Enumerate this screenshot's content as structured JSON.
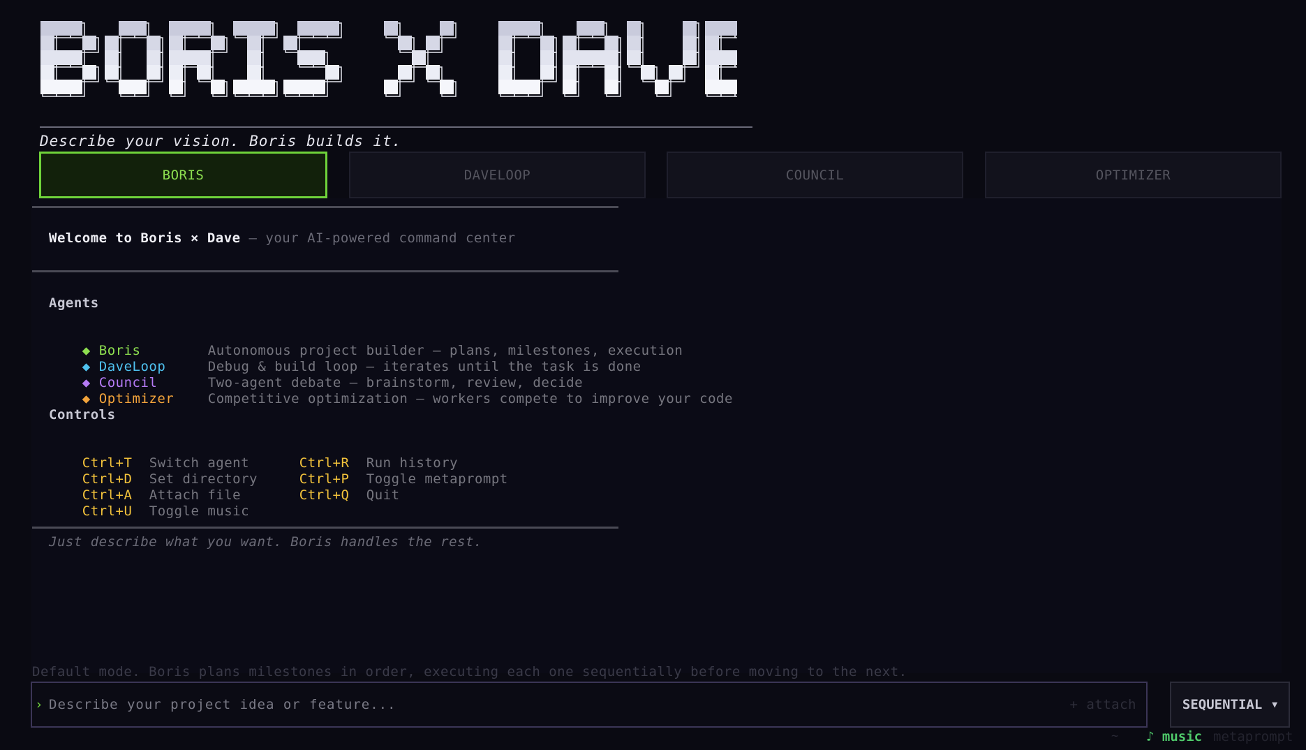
{
  "app": {
    "logo_text": "BORIS X DAVE",
    "tagline": "Describe your vision. Boris builds it."
  },
  "tabs": [
    {
      "label": "BORIS",
      "active": true
    },
    {
      "label": "DAVELOOP",
      "active": false
    },
    {
      "label": "COUNCIL",
      "active": false
    },
    {
      "label": "OPTIMIZER",
      "active": false
    }
  ],
  "welcome": {
    "bold": "Welcome to Boris × Dave",
    "rest": " — your AI-powered command center"
  },
  "agents": {
    "title": "Agents",
    "items": [
      {
        "diamond": "◆",
        "name": "Boris",
        "desc": "Autonomous project builder — plans, milestones, execution",
        "color": "#8ee050"
      },
      {
        "diamond": "◆",
        "name": "DaveLoop",
        "desc": "Debug & build loop — iterates until the task is done",
        "color": "#4fc2f0"
      },
      {
        "diamond": "◆",
        "name": "Council",
        "desc": "Two-agent debate — brainstorm, review, decide",
        "color": "#b57bf5"
      },
      {
        "diamond": "◆",
        "name": "Optimizer",
        "desc": "Competitive optimization — workers compete to improve your code",
        "color": "#f2a33b"
      }
    ]
  },
  "controls": {
    "title": "Controls",
    "left": [
      {
        "key": "Ctrl+T",
        "action": "Switch agent"
      },
      {
        "key": "Ctrl+D",
        "action": "Set directory"
      },
      {
        "key": "Ctrl+A",
        "action": "Attach file"
      },
      {
        "key": "Ctrl+U",
        "action": "Toggle music"
      }
    ],
    "right": [
      {
        "key": "Ctrl+R",
        "action": "Run history"
      },
      {
        "key": "Ctrl+P",
        "action": "Toggle metaprompt"
      },
      {
        "key": "Ctrl+Q",
        "action": "Quit"
      }
    ]
  },
  "footer_text": "Just describe what you want. Boris handles the rest.",
  "mode_description": "Default mode. Boris plans milestones in order, executing each one sequentially before moving to the next.",
  "input": {
    "prompt": "›",
    "placeholder": "Describe your project idea or feature...",
    "value": "",
    "attach_label": "+ attach"
  },
  "mode_select": {
    "value": "SEQUENTIAL",
    "caret": "▼"
  },
  "status": {
    "tilde": "~",
    "music": "♪ music",
    "metaprompt": "metaprompt"
  },
  "colors": {
    "accent_green": "#6fd33a",
    "key_yellow": "#f2c23b",
    "background": "#0a0a12"
  }
}
